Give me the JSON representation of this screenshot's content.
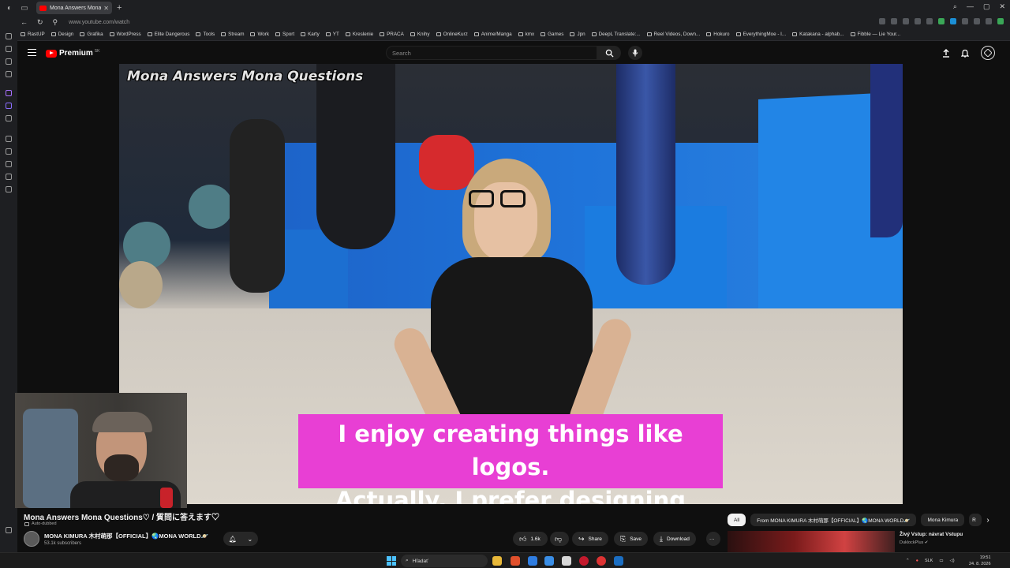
{
  "browser": {
    "tab_title": "Mona Answers Mona Q",
    "url": "www.youtube.com/watch",
    "bookmarks": [
      "RastUP",
      "Design",
      "Grafika",
      "WordPress",
      "Elite Dangerous",
      "Tools",
      "Stream",
      "Work",
      "Sport",
      "Karty",
      "YT",
      "Kreslenie",
      "PRACA",
      "Knihy",
      "OnlineKurz",
      "Anime/Manga",
      "kmx",
      "Games",
      "Jpn",
      "DeepL Translate:...",
      "Reel Videos, Down...",
      "Hokuro",
      "EverythingMoe - I...",
      "Katakana - alphab...",
      "Fibble — Lie Your..."
    ]
  },
  "youtube": {
    "logo_text": "Premium",
    "logo_sup": "SK",
    "search_placeholder": "Search"
  },
  "video": {
    "overlay_title": "Mona Answers Mona Questions",
    "caption_line1": "I enjoy creating things like logos.",
    "caption_line2": "Actually, I prefer designing logos.",
    "title": "Mona Answers Mona Questions♡ / 質問に答えます♡",
    "auto_dubbed": "Auto-dubbed",
    "channel_name": "MONA KIMURA 木村萌那【OFFICIAL】🌏MONA WORLD🪐",
    "subscribers": "53.1k subscribers",
    "likes": "1.6k",
    "share_label": "Share",
    "save_label": "Save",
    "download_label": "Download",
    "more_label": "···"
  },
  "chips": [
    "All",
    "From MONA KIMURA 木村萌那【OFFICIAL】🌏MONA WORLD🪐",
    "Mona Kimura",
    "R"
  ],
  "related": {
    "title": "Živý Vstup: návrat Vstupu",
    "channel": "DuklockPlus"
  },
  "taskbar": {
    "search_placeholder": "Hľadať",
    "lang": "SLK",
    "time": "19:51",
    "date": "24. 8. 2026"
  }
}
